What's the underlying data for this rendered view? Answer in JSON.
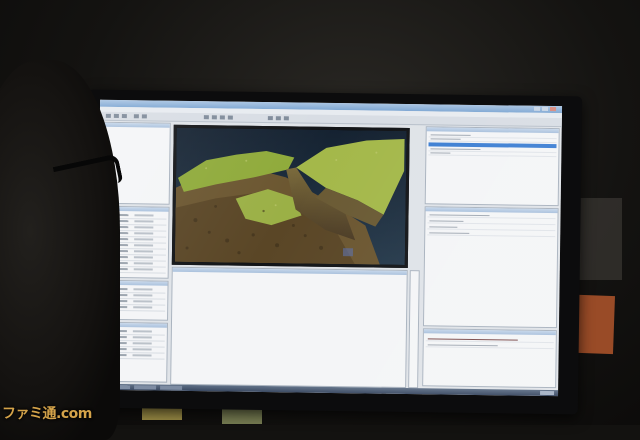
{
  "scene": {
    "description_domain": "photo-of-monitor",
    "accent_colors": {
      "window_title": "#7ea7d3",
      "selection": "#3d7fd3",
      "terrain_green": "#8faa3a",
      "terrain_brown": "#6a4a2c",
      "water": "#1a2a38",
      "sticky_note": "#b2562c"
    }
  },
  "watermark": {
    "text": "ファミ通.com"
  },
  "icons": [
    "window-minimize-icon",
    "window-maximize-icon",
    "window-close-icon",
    "toolbar-icon",
    "start-icon"
  ]
}
